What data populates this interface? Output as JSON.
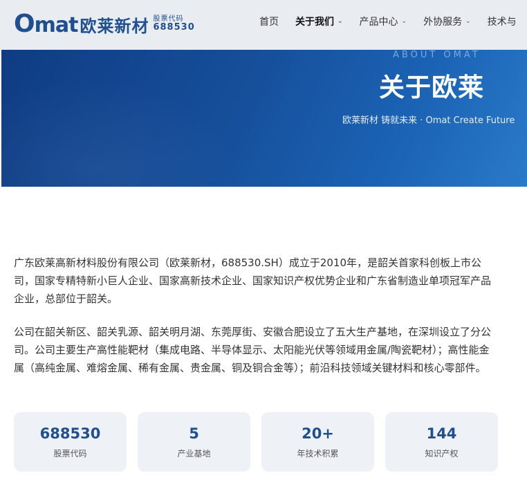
{
  "header": {
    "logo": {
      "o": "O",
      "mat": "mat",
      "name_cn": "欧莱新材",
      "stock_label": "股票代码",
      "stock_code": "688530"
    },
    "nav": [
      {
        "label": "首页",
        "dropdown": false,
        "active": false
      },
      {
        "label": "关于我们",
        "dropdown": true,
        "active": true
      },
      {
        "label": "产品中心",
        "dropdown": true,
        "active": false
      },
      {
        "label": "外协服务",
        "dropdown": true,
        "active": false
      },
      {
        "label": "技术与",
        "dropdown": false,
        "active": false
      }
    ],
    "chevron": "⌄"
  },
  "banner": {
    "subtitle_en": "ABOUT OMAT",
    "title": "关于欧莱",
    "slogan": "欧莱新材 铸就未来 · Omat Create Future"
  },
  "intro": {
    "p1": "广东欧莱高新材料股份有限公司（欧莱新材，688530.SH）成立于2010年，是韶关首家科创板上市公司，国家专精特新小巨人企业、国家高新技术企业、国家知识产权优势企业和广东省制造业单项冠军产品企业，总部位于韶关。",
    "p2": "公司在韶关新区、韶关乳源、韶关明月湖、东莞厚街、安徽合肥设立了五大生产基地，在深圳设立了分公司。公司主要生产高性能靶材（集成电路、半导体显示、太阳能光伏等领域用金属/陶瓷靶材）；高性能金属（高纯金属、难熔金属、稀有金属、贵金属、铜及铜合金等）；前沿科技领域关键材料和核心零部件。"
  },
  "stats": [
    {
      "value": "688530",
      "label": "股票代码"
    },
    {
      "value": "5",
      "label": "产业基地"
    },
    {
      "value": "20+",
      "label": "年技术积累"
    },
    {
      "value": "144",
      "label": "知识产权"
    }
  ],
  "colors": {
    "brand": "#1f4f8f",
    "header_bg": "#e9edf2",
    "banner_start": "#0f3c83",
    "banner_end": "#2a7ac8",
    "stat_bg": "#eef2f7"
  }
}
